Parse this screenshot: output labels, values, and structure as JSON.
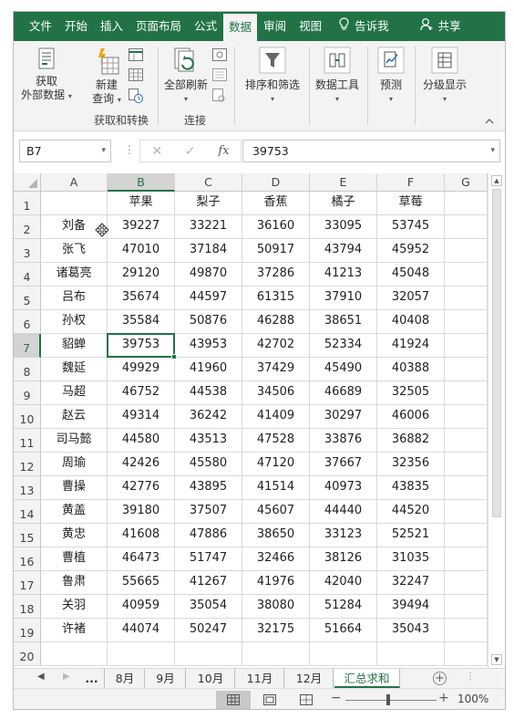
{
  "ribbon_tabs": [
    {
      "label": "文件"
    },
    {
      "label": "开始"
    },
    {
      "label": "插入"
    },
    {
      "label": "页面布局"
    },
    {
      "label": "公式"
    },
    {
      "label": "数据"
    },
    {
      "label": "审阅"
    },
    {
      "label": "视图"
    },
    {
      "label": "告诉我"
    },
    {
      "label": "共享"
    }
  ],
  "active_tab": "数据",
  "ribbon": {
    "get_external_1": "获取",
    "get_external_2": "外部数据",
    "new_query_1": "新建",
    "new_query_2": "查询",
    "group_get_transform": "获取和转换",
    "refresh_all": "全部刷新",
    "group_connections": "连接",
    "sort_filter": "排序和筛选",
    "data_tools": "数据工具",
    "forecast": "预测",
    "outline": "分级显示"
  },
  "formula_bar": {
    "name_box": "B7",
    "fx": "fx",
    "value": "39753"
  },
  "columns": [
    "A",
    "B",
    "C",
    "D",
    "E",
    "F",
    "G"
  ],
  "selected_column": "B",
  "selected_row": 7,
  "selected_cell": "B7",
  "row_numbers": [
    "1",
    "2",
    "3",
    "4",
    "5",
    "6",
    "7",
    "8",
    "9",
    "10",
    "11",
    "12",
    "13",
    "14",
    "15",
    "16",
    "17",
    "18",
    "19",
    "20"
  ],
  "table": {
    "headers": [
      "",
      "苹果",
      "梨子",
      "香蕉",
      "橘子",
      "草莓"
    ],
    "rows": [
      [
        "刘备",
        "39227",
        "33221",
        "36160",
        "33095",
        "53745"
      ],
      [
        "张飞",
        "47010",
        "37184",
        "50917",
        "43794",
        "45952"
      ],
      [
        "诸葛亮",
        "29120",
        "49870",
        "37286",
        "41213",
        "45048"
      ],
      [
        "吕布",
        "35674",
        "44597",
        "61315",
        "37910",
        "32057"
      ],
      [
        "孙权",
        "35584",
        "50876",
        "46288",
        "38651",
        "40408"
      ],
      [
        "貂蝉",
        "39753",
        "43953",
        "42702",
        "52334",
        "41924"
      ],
      [
        "魏延",
        "49929",
        "41960",
        "37429",
        "45490",
        "40388"
      ],
      [
        "马超",
        "46752",
        "44538",
        "34506",
        "46689",
        "32505"
      ],
      [
        "赵云",
        "49314",
        "36242",
        "41409",
        "30297",
        "46006"
      ],
      [
        "司马懿",
        "44580",
        "43513",
        "47528",
        "33876",
        "36882"
      ],
      [
        "周瑜",
        "42426",
        "45580",
        "47120",
        "37667",
        "32356"
      ],
      [
        "曹操",
        "42776",
        "43895",
        "41514",
        "40973",
        "43835"
      ],
      [
        "黄盖",
        "39180",
        "37507",
        "45607",
        "44440",
        "44520"
      ],
      [
        "黄忠",
        "41608",
        "47886",
        "38650",
        "33123",
        "52521"
      ],
      [
        "曹植",
        "46473",
        "51747",
        "32466",
        "38126",
        "31035"
      ],
      [
        "鲁肃",
        "55665",
        "41267",
        "41976",
        "42040",
        "32247"
      ],
      [
        "关羽",
        "40959",
        "35054",
        "38080",
        "51284",
        "39494"
      ],
      [
        "许褚",
        "44074",
        "50247",
        "32175",
        "51664",
        "35043"
      ]
    ]
  },
  "sheet_tabs": [
    {
      "label": "..."
    },
    {
      "label": "8月"
    },
    {
      "label": "9月"
    },
    {
      "label": "10月"
    },
    {
      "label": "11月"
    },
    {
      "label": "12月"
    },
    {
      "label": "汇总求和"
    }
  ],
  "active_sheet": "汇总求和",
  "status": {
    "zoom": "100%"
  },
  "colors": {
    "accent": "#217346",
    "ribbon_bg": "#f3f3f3",
    "header_bg": "#f3f3f3"
  }
}
